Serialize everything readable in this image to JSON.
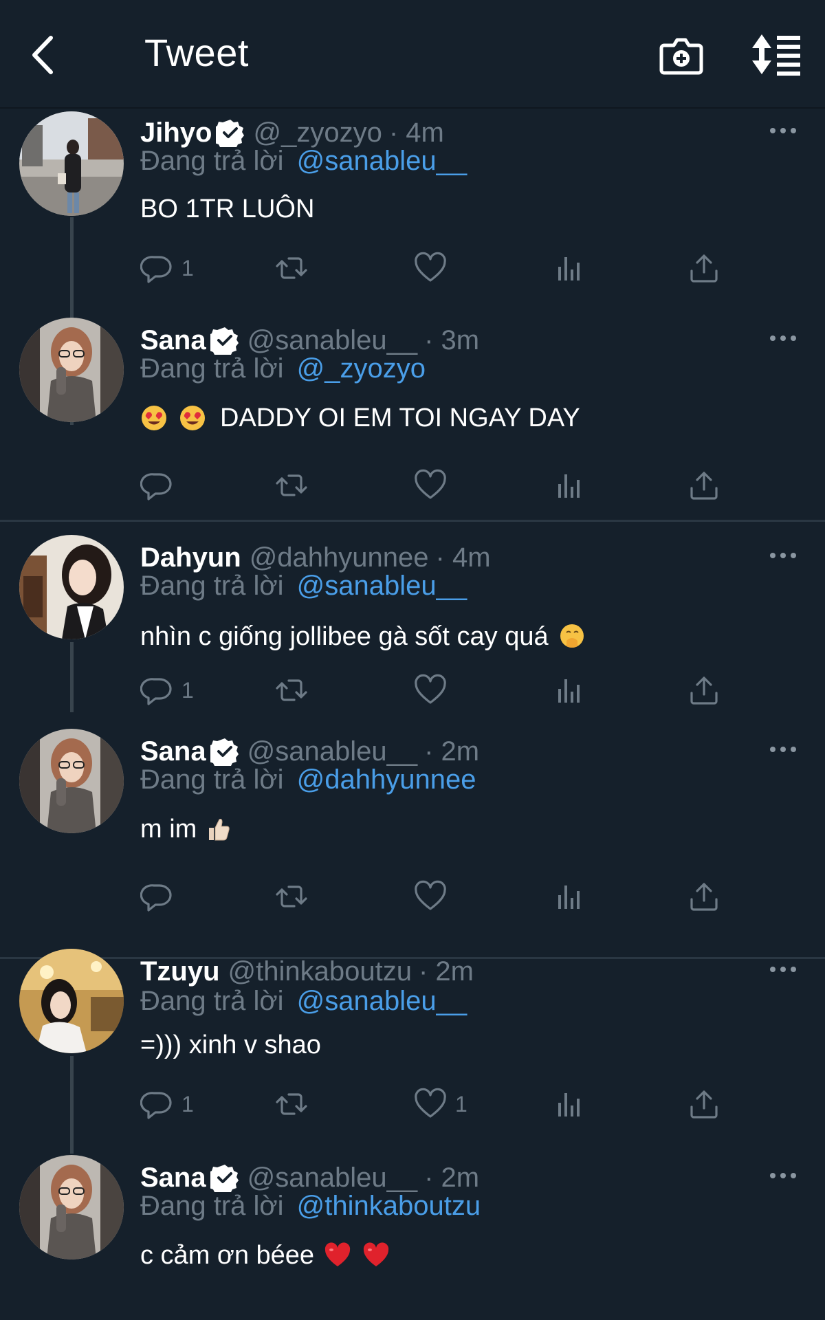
{
  "header": {
    "title": "Tweet",
    "back_icon": "chevron-left-icon",
    "camera_icon": "camera-plus-icon",
    "sort_icon": "sort-list-icon"
  },
  "colors": {
    "background": "#15202b",
    "mention": "#4a9ee8",
    "muted": "#6e7b87",
    "verified": "#ffffff"
  },
  "tweets": [
    {
      "name": "Jihyo",
      "handle": "@_zyozyo",
      "time": "· 4m",
      "reply_prefix": "Đang trả lời",
      "reply_to": "@sanableu__",
      "text": "BO 1TR LUÔN",
      "reply_count": "1",
      "like_count": ""
    },
    {
      "name": "Sana",
      "handle": "@sanableu__",
      "time": "· 3m",
      "reply_prefix": "Đang trả lời",
      "reply_to": "@_zyozyo",
      "text": "DADDY OI EM TOI NGAY DAY",
      "reply_count": "",
      "like_count": ""
    },
    {
      "name": "Dahyun",
      "handle": "@dahhyunnee",
      "time": "· 4m",
      "reply_prefix": "Đang trả lời",
      "reply_to": "@sanableu__",
      "text": "nhìn c giống jollibee gà sốt cay quá",
      "reply_count": "1",
      "like_count": ""
    },
    {
      "name": "Sana",
      "handle": "@sanableu__",
      "time": "· 2m",
      "reply_prefix": "Đang trả lời",
      "reply_to": "@dahhyunnee",
      "text": "m im",
      "reply_count": "",
      "like_count": ""
    },
    {
      "name": "Tzuyu",
      "handle": "@thinkaboutzu",
      "time": "· 2m",
      "reply_prefix": "Đang trả lời",
      "reply_to": "@sanableu__",
      "text": "=))) xinh v shao",
      "reply_count": "1",
      "like_count": "1"
    },
    {
      "name": "Sana",
      "handle": "@sanableu__",
      "time": "· 2m",
      "reply_prefix": "Đang trả lời",
      "reply_to": "@thinkaboutzu",
      "text": "c cảm ơn béee",
      "reply_count": "",
      "like_count": ""
    }
  ]
}
